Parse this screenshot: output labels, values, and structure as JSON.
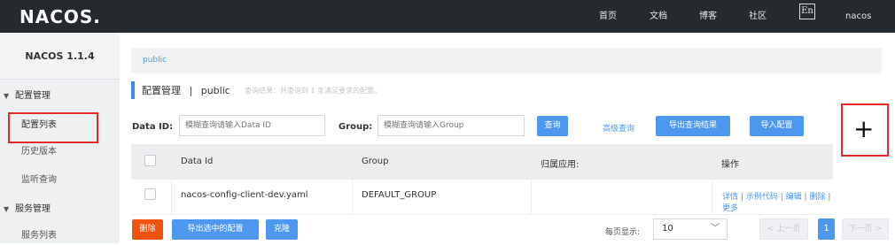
{
  "app": {
    "logo": "NACOS."
  },
  "topnav": {
    "items": [
      "首页",
      "文档",
      "博客",
      "社区"
    ],
    "lang": "En",
    "user": "nacos"
  },
  "sidebar": {
    "version": "NACOS 1.1.4",
    "groups": [
      {
        "label": "配置管理",
        "items": [
          "配置列表",
          "历史版本",
          "监听查询"
        ]
      },
      {
        "label": "服务管理",
        "items": [
          "服务列表"
        ]
      }
    ]
  },
  "breadcrumb": "public",
  "page": {
    "title": "配置管理",
    "separator": "|",
    "namespace": "public",
    "hint": "查询结果：共查询到 1 条满足要求的配置。"
  },
  "search": {
    "dataid_label": "Data ID:",
    "dataid_placeholder": "模糊查询请输入Data ID",
    "group_label": "Group:",
    "group_placeholder": "模糊查询请输入Group",
    "query_button": "查询",
    "advanced_link": "高级查询",
    "export_button": "导出查询结果",
    "import_button": "导入配置",
    "add_icon": "+"
  },
  "table": {
    "headers": [
      "Data Id",
      "Group",
      "归属应用:",
      "操作"
    ],
    "rows": [
      {
        "data_id": "nacos-config-client-dev.yaml",
        "group": "DEFAULT_GROUP",
        "app": "",
        "ops": [
          "详情",
          "示例代码",
          "编辑",
          "删除",
          "更多"
        ]
      }
    ]
  },
  "footer": {
    "delete_button": "删除",
    "export_selected_button": "导出选中的配置",
    "clone_button": "克隆",
    "page_size_label": "每页显示:",
    "page_size": "10",
    "prev": "< 上一页",
    "page": "1",
    "next": "下一页 >"
  },
  "colors": {
    "topbar": "#252a2f",
    "primary": "#4d97ee",
    "danger": "#f0520f",
    "highlight": "#e32a2a"
  }
}
